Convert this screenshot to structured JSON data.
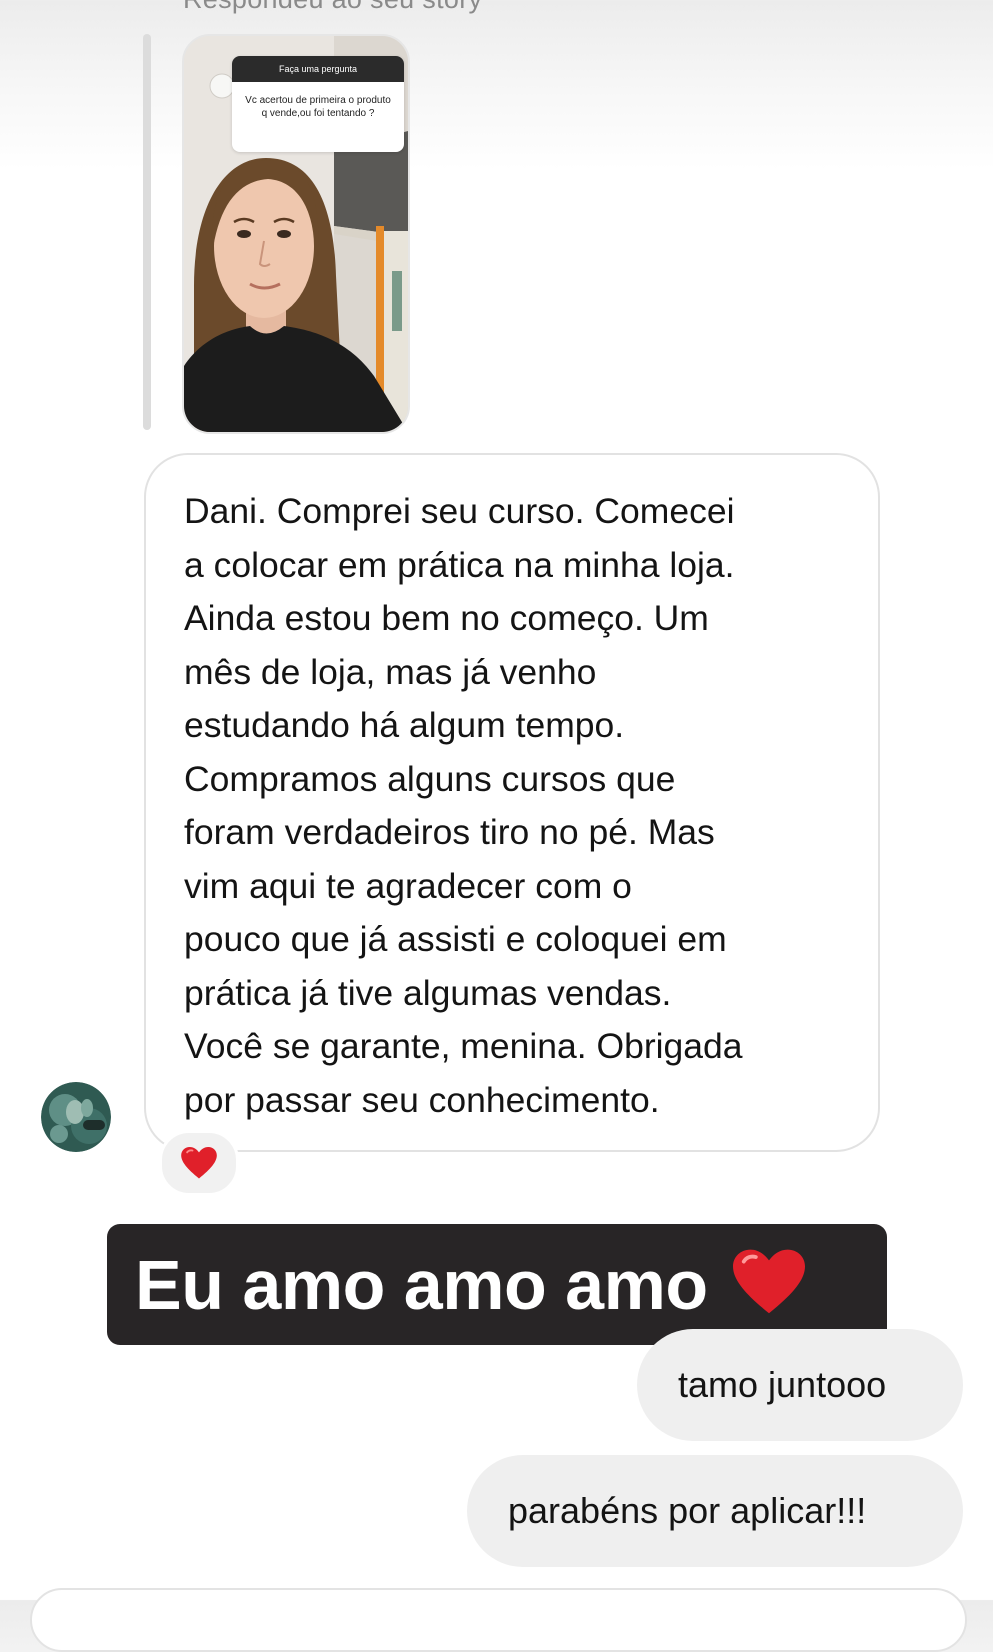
{
  "story_reply": {
    "caption": "Respondeu ao seu story",
    "question_sticker": {
      "header": "Faça uma pergunta",
      "question": "Vc acertou de primeira o produto q vende,ou foi tentando ?"
    }
  },
  "incoming_message": {
    "text": "Dani. Comprei seu curso. Comecei\na colocar em prática na minha loja.\nAinda estou bem no começo. Um\nmês de loja, mas já venho\nestudando há algum tempo.\nCompramos alguns cursos que\nforam verdadeiros tiro no pé. Mas\nvim aqui te agradecer com o\npouco que já assisti e coloquei em\nprática já tive algumas vendas.\nVocê se garante, menina. Obrigada\npor passar seu conhecimento.",
    "reaction_icon": "red-heart-icon"
  },
  "sticker": {
    "text": "Eu amo amo amo",
    "icon": "red-heart-icon"
  },
  "outgoing_messages": [
    {
      "text": "tamo juntooo"
    },
    {
      "text": "parabéns por aplicar!!!"
    }
  ],
  "colors": {
    "heart": "#e0202a",
    "sticker_bg": "#282526",
    "outgoing_bubble": "#efefef",
    "incoming_border": "#e2e2e2",
    "caption": "#8a8a8a"
  }
}
